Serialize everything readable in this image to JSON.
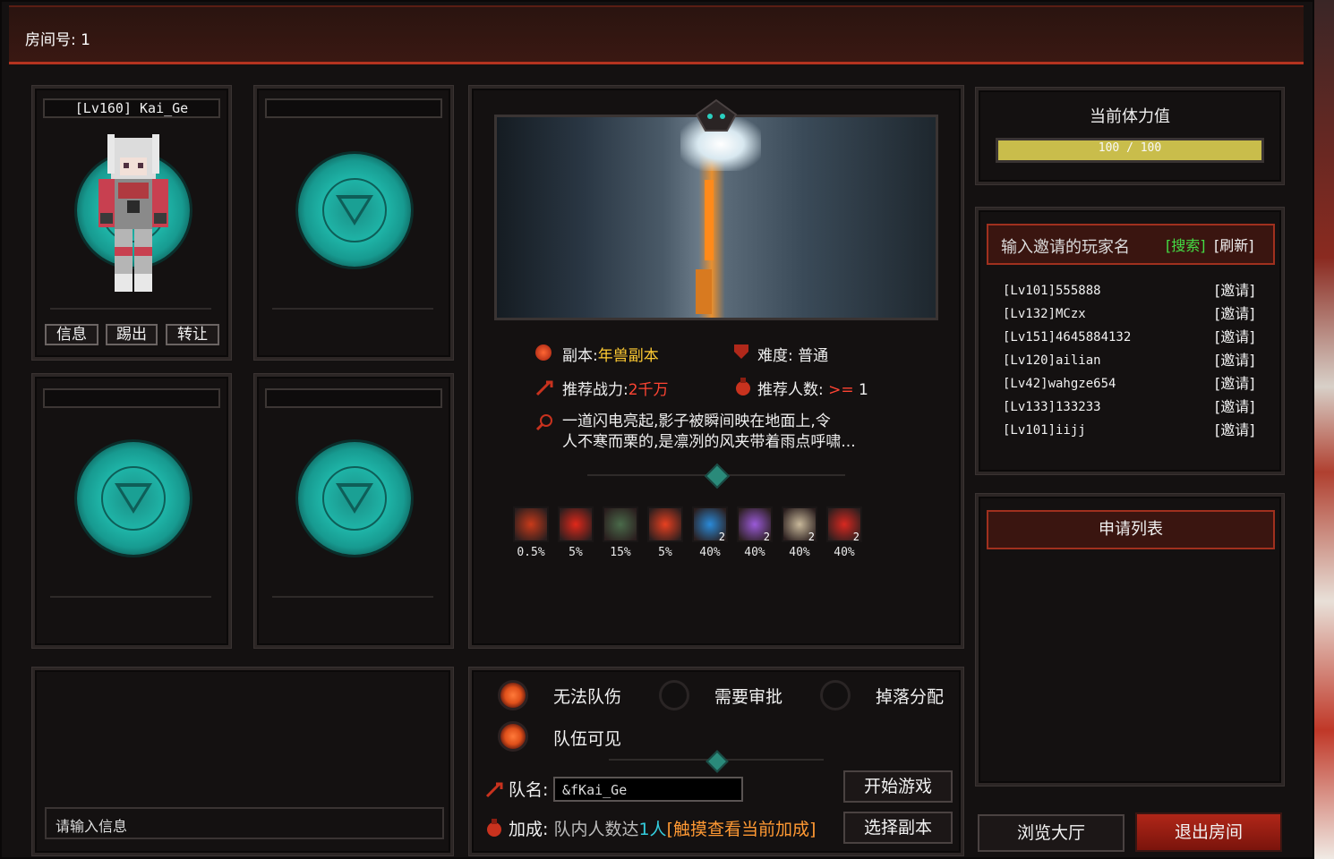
{
  "room": {
    "label": "房间号: 1"
  },
  "slots": [
    {
      "name": "[Lv160] Kai_Ge",
      "occupied": true,
      "buttons": [
        {
          "label": "信息"
        },
        {
          "label": "踢出"
        },
        {
          "label": "转让"
        }
      ]
    },
    {
      "name": "",
      "occupied": false
    },
    {
      "name": "",
      "occupied": false
    },
    {
      "name": "",
      "occupied": false
    }
  ],
  "chat": {
    "placeholder": "请输入信息"
  },
  "dungeon": {
    "name_label": "副本:",
    "name_value": "年兽副本",
    "difficulty_label": "难度:",
    "difficulty_value": "普通",
    "power_label": "推荐战力:",
    "power_value": "2千万",
    "players_label": "推荐人数:",
    "players_op": ">=",
    "players_value": "1",
    "desc_line1": "一道闪电亮起,影子被瞬间映在地面上,令",
    "desc_line2": "人不寒而栗的,是凛冽的风夹带着雨点呼啸...",
    "rewards": [
      {
        "icon": "red-orb-icon",
        "chance": "0.5%",
        "count": "",
        "color": "#c83a1a"
      },
      {
        "icon": "red-envelope-icon",
        "chance": "5%",
        "count": "",
        "color": "#e0281a"
      },
      {
        "icon": "treasure-chest-icon",
        "chance": "15%",
        "count": "",
        "color": "#4a6a4a"
      },
      {
        "icon": "wan-charm-icon",
        "chance": "5%",
        "count": "",
        "color": "#e84020"
      },
      {
        "icon": "blue-crystal-icon",
        "chance": "40%",
        "count": "2",
        "color": "#2a8ad8"
      },
      {
        "icon": "purple-shard-icon",
        "chance": "40%",
        "count": "2",
        "color": "#9a5ad8"
      },
      {
        "icon": "crossed-bones-icon",
        "chance": "40%",
        "count": "2",
        "color": "#c8b89a"
      },
      {
        "icon": "red-cloth-icon",
        "chance": "40%",
        "count": "2",
        "color": "#d82820"
      }
    ]
  },
  "options": {
    "no_friendly_fire": {
      "label": "无法队伤",
      "on": true
    },
    "need_approval": {
      "label": "需要审批",
      "on": false
    },
    "loot_distribution": {
      "label": "掉落分配",
      "on": false
    },
    "team_visible": {
      "label": "队伍可见",
      "on": true
    },
    "team_name_label": "队名:",
    "team_name_value": "&fKai_Ge",
    "bonus_label": "加成:",
    "bonus_text_a": "队内人数达",
    "bonus_text_b": "1人",
    "bonus_text_c": "[触摸查看当前加成]",
    "start_button": "开始游戏",
    "select_button": "选择副本"
  },
  "stamina": {
    "title": "当前体力值",
    "text": "100 / 100",
    "current": 100,
    "max": 100
  },
  "invite": {
    "placeholder": "输入邀请的玩家名",
    "search": "[搜索]",
    "refresh": "[刷新]",
    "invite_label": "[邀请]",
    "players": [
      "[Lv101]555888",
      "[Lv132]MCzx",
      "[Lv151]4645884132",
      "[Lv120]ailian",
      "[Lv42]wahgze654",
      "[Lv133]133233",
      "[Lv101]iijj"
    ]
  },
  "apply": {
    "title": "申请列表"
  },
  "footer": {
    "lobby": "浏览大厅",
    "exit": "退出房间"
  },
  "colors": {
    "accent": "#b5331f",
    "teal": "#1fb5a8",
    "gold": "#ffcc33",
    "green": "#44dd44"
  }
}
